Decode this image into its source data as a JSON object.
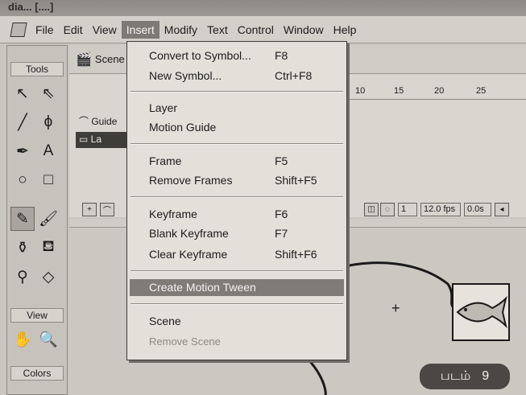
{
  "window": {
    "title": "dia... [....]"
  },
  "menubar": {
    "items": [
      "File",
      "Edit",
      "View",
      "Insert",
      "Modify",
      "Text",
      "Control",
      "Window",
      "Help"
    ],
    "active_index": 3
  },
  "tools": {
    "label": "Tools",
    "view_label": "View",
    "colors_label": "Colors",
    "icons": [
      "arrow-icon",
      "subselect-icon",
      "line-icon",
      "lasso-icon",
      "pen-icon",
      "text-icon",
      "oval-icon",
      "rectangle-icon",
      "pencil-icon",
      "brush-icon",
      "ink-bottle-icon",
      "paint-bucket-icon",
      "eyedropper-icon",
      "eraser-icon",
      "hand-icon",
      "zoom-icon"
    ]
  },
  "scene": {
    "label": "Scene"
  },
  "timeline": {
    "ruler_numbers": [
      "10",
      "15",
      "20",
      "25"
    ],
    "layers": [
      "Guide",
      "La"
    ],
    "frame": "1",
    "fps": "12.0 fps",
    "time": "0.0s"
  },
  "dropdown": {
    "groups": [
      [
        {
          "label": "Convert to Symbol...",
          "shortcut": "F8"
        },
        {
          "label": "New Symbol...",
          "shortcut": "Ctrl+F8"
        }
      ],
      [
        {
          "label": "Layer",
          "shortcut": ""
        },
        {
          "label": "Motion Guide",
          "shortcut": ""
        }
      ],
      [
        {
          "label": "Frame",
          "shortcut": "F5"
        },
        {
          "label": "Remove Frames",
          "shortcut": "Shift+F5"
        }
      ],
      [
        {
          "label": "Keyframe",
          "shortcut": "F6"
        },
        {
          "label": "Blank Keyframe",
          "shortcut": "F7"
        },
        {
          "label": "Clear Keyframe",
          "shortcut": "Shift+F6"
        }
      ],
      [
        {
          "label": "Create Motion Tween",
          "shortcut": "",
          "highlighted": true
        }
      ],
      [
        {
          "label": "Scene",
          "shortcut": ""
        },
        {
          "label": "Remove Scene",
          "shortcut": "",
          "disabled": true
        }
      ]
    ]
  },
  "badge": {
    "word": "படம்",
    "number": "9"
  },
  "colors": {
    "menu_highlight": "#7f7c77",
    "badge_bg": "#4a4744"
  }
}
